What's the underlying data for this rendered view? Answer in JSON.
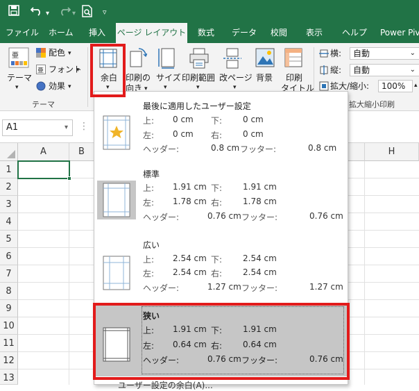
{
  "quick_access": {
    "save_icon": "save-icon",
    "undo_icon": "undo-icon",
    "redo_icon": "redo-icon",
    "preview_icon": "print-preview-icon",
    "customize_icon": "customize-qat-icon"
  },
  "tabs": [
    {
      "label": "ファイル"
    },
    {
      "label": "ホーム"
    },
    {
      "label": "挿入"
    },
    {
      "label": "ページ レイアウト",
      "active": true
    },
    {
      "label": "数式"
    },
    {
      "label": "データ"
    },
    {
      "label": "校閲"
    },
    {
      "label": "表示"
    },
    {
      "label": "ヘルプ"
    },
    {
      "label": "Power Piv"
    }
  ],
  "ribbon": {
    "theme_group": {
      "theme_label": "テーマ",
      "colors_label": "配色",
      "fonts_label": "フォント",
      "effects_label": "効果",
      "group_label": "テーマ"
    },
    "margins_label": "余白",
    "orientation_label_1": "印刷の",
    "orientation_label_2": "向き",
    "size_label": "サイズ",
    "print_area_label": "印刷範囲",
    "breaks_label": "改ページ",
    "background_label": "背景",
    "print_titles_label_1": "印刷",
    "print_titles_label_2": "タイトル",
    "scale": {
      "width_label": "横:",
      "width_value": "自動",
      "height_label": "縦:",
      "height_value": "自動",
      "scale_label": "拡大/縮小:",
      "scale_value": "100%",
      "group_label": "拡大縮小印刷"
    }
  },
  "formula_bar": {
    "name_box": "A1"
  },
  "grid": {
    "columns": [
      "A",
      "B",
      "H"
    ],
    "rows": [
      "1",
      "2",
      "3",
      "4",
      "5",
      "6",
      "7",
      "8",
      "9",
      "10",
      "11",
      "12",
      "13"
    ]
  },
  "margins_menu": {
    "options": [
      {
        "title": "最後に適用したユーザー設定",
        "top_label": "上:",
        "top": "0 cm",
        "bottom_label": "下:",
        "bottom": "0 cm",
        "left_label": "左:",
        "left": "0 cm",
        "right_label": "右:",
        "right": "0 cm",
        "header_label": "ヘッダー:",
        "header": "0.8 cm",
        "footer_label": "フッター:",
        "footer": "0.8 cm",
        "icon": "custom-margins-star-icon"
      },
      {
        "title": "標準",
        "top_label": "上:",
        "top": "1.91 cm",
        "bottom_label": "下:",
        "bottom": "1.91 cm",
        "left_label": "左:",
        "left": "1.78 cm",
        "right_label": "右:",
        "right": "1.78 cm",
        "header_label": "ヘッダー:",
        "header": "0.76 cm",
        "footer_label": "フッター:",
        "footer": "0.76 cm",
        "icon": "normal-margins-icon"
      },
      {
        "title": "広い",
        "top_label": "上:",
        "top": "2.54 cm",
        "bottom_label": "下:",
        "bottom": "2.54 cm",
        "left_label": "左:",
        "left": "2.54 cm",
        "right_label": "右:",
        "right": "2.54 cm",
        "header_label": "ヘッダー:",
        "header": "1.27 cm",
        "footer_label": "フッター:",
        "footer": "1.27 cm",
        "icon": "wide-margins-icon"
      },
      {
        "title": "狭い",
        "top_label": "上:",
        "top": "1.91 cm",
        "bottom_label": "下:",
        "bottom": "1.91 cm",
        "left_label": "左:",
        "left": "0.64 cm",
        "right_label": "右:",
        "right": "0.64 cm",
        "header_label": "ヘッダー:",
        "header": "0.76 cm",
        "footer_label": "フッター:",
        "footer": "0.76 cm",
        "icon": "narrow-margins-icon"
      }
    ],
    "custom_label": "ユーザー設定の余白(A)..."
  },
  "colors": {
    "excel_green": "#217346",
    "highlight_red": "#e21b1b",
    "hover_gray": "#c6c6c6"
  }
}
